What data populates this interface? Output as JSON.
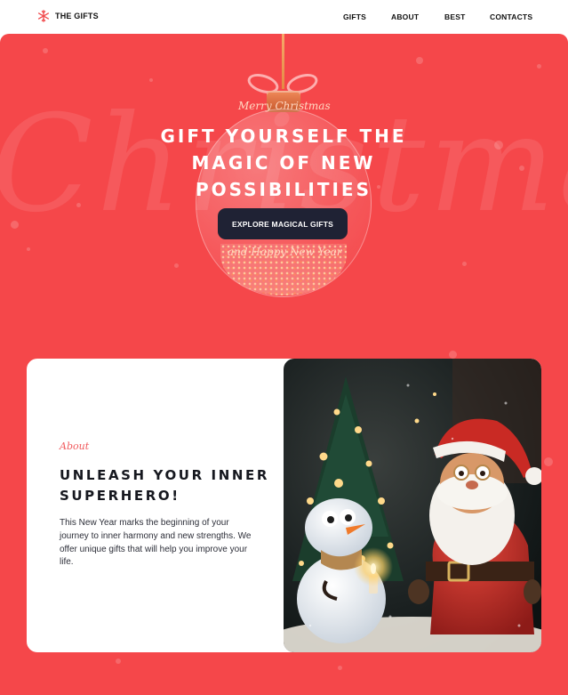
{
  "header": {
    "logo_text": "THE GIFTS",
    "logo_icon": "snowflake-icon",
    "nav": [
      {
        "label": "GIFTS"
      },
      {
        "label": "ABOUT"
      },
      {
        "label": "BEST"
      },
      {
        "label": "CONTACTS"
      }
    ]
  },
  "hero": {
    "bg_word": "Christmas",
    "script_top": "Merry Christmas",
    "title": "GIFT YOURSELF THE MAGIC OF NEW POSSIBILITIES",
    "cta_label": "EXPLORE MAGICAL GIFTS",
    "script_bottom": "and Happy New Year",
    "colors": {
      "background": "#f5474a",
      "button": "#1f2234"
    }
  },
  "about": {
    "eyebrow": "About",
    "title": "UNLEASH YOUR INNER SUPERHERO!",
    "body": "This New Year marks the beginning of your journey to inner harmony and new strengths. We offer unique gifts that will help you improve your life.",
    "image_subject": "santa-and-snowman-image"
  }
}
